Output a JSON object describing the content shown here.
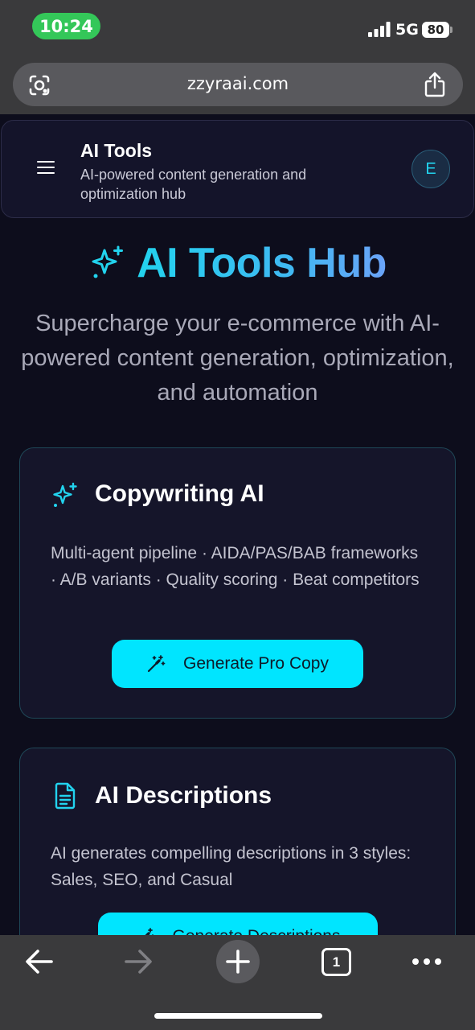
{
  "status_bar": {
    "time": "10:24",
    "network": "5G",
    "battery": "80"
  },
  "browser": {
    "url": "zzyraai.com"
  },
  "header": {
    "title": "AI Tools",
    "subtitle": "AI-powered content generation and optimization hub",
    "avatar_initial": "E"
  },
  "hero": {
    "title": "AI Tools Hub",
    "subtitle": "Supercharge your e-commerce with AI-powered content generation, optimization, and automation"
  },
  "cards": [
    {
      "icon": "sparkles-icon",
      "title": "Copywriting AI",
      "description": "Multi-agent pipeline · AIDA/PAS/BAB frameworks · A/B variants · Quality scoring · Beat competitors",
      "button_label": "Generate Pro Copy"
    },
    {
      "icon": "document-icon",
      "title": "AI Descriptions",
      "description": "AI generates compelling descriptions in 3 styles: Sales, SEO, and Casual",
      "button_label": "Generate Descriptions"
    }
  ],
  "bottom_bar": {
    "tab_count": "1"
  },
  "colors": {
    "accent": "#00e5ff",
    "background": "#0d0d1c",
    "card": "#15152a",
    "status_green": "#34c759"
  }
}
